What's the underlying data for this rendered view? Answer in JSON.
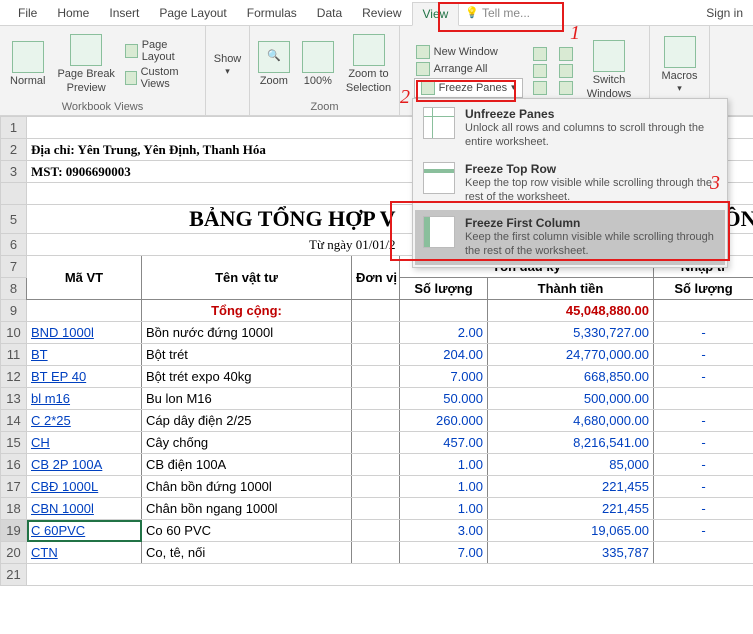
{
  "tabs": [
    "File",
    "Home",
    "Insert",
    "Page Layout",
    "Formulas",
    "Data",
    "Review",
    "View"
  ],
  "active_tab": "View",
  "tell_me": "Tell me...",
  "sign_in": "Sign in",
  "ribbon": {
    "workbook_views": {
      "label": "Workbook Views",
      "normal": "Normal",
      "page_break": "Page Break\nPreview",
      "page_layout": "Page Layout",
      "custom_views": "Custom Views"
    },
    "show": {
      "label": "Show"
    },
    "zoom": {
      "label": "Zoom",
      "zoom": "Zoom",
      "hundred": "100%",
      "zoom_to_selection": "Zoom to\nSelection"
    },
    "window": {
      "new_window": "New Window",
      "arrange_all": "Arrange All",
      "freeze_panes": "Freeze Panes",
      "switch_windows": "Switch\nWindows"
    },
    "macros": {
      "label": "Macros"
    }
  },
  "freeze_dropdown": [
    {
      "title": "Unfreeze Panes",
      "desc": "Unlock all rows and columns to scroll through the entire worksheet."
    },
    {
      "title": "Freeze Top Row",
      "desc": "Keep the top row visible while scrolling through the rest of the worksheet."
    },
    {
      "title": "Freeze First Column",
      "desc": "Keep the first column visible while scrolling through the rest of the worksheet."
    }
  ],
  "annotations": {
    "1": "1",
    "2": "2",
    "3": "3"
  },
  "doc": {
    "address": "Địa chỉ: Yên Trung, Yên Định, Thanh Hóa",
    "mst": "MST:  0906690003",
    "title": "BẢNG TỔNG HỢP V",
    "title_suffix": "ỒN",
    "date": "Từ ngày 01/01/2",
    "headers": {
      "ma_vt": "Mã VT",
      "ten_vt": "Tên vật tư",
      "dvi": "Đơn vị",
      "ton_dau": "Tồn đầu kỳ",
      "so_luong": "Số lượng",
      "thanh_tien": "Thành tiền",
      "nhap": "Nhập tr"
    },
    "tong_cong": "Tổng cộng:",
    "tong_value": "45,048,880.00",
    "rows": [
      {
        "n": "10",
        "ma": "BND 1000l",
        "ten": "Bồn nước đứng 1000l",
        "sl": "2.00",
        "tt": "5,330,727.00",
        "nt": "-"
      },
      {
        "n": "11",
        "ma": "BT",
        "ten": "Bột trét",
        "sl": "204.00",
        "tt": "24,770,000.00",
        "nt": "-"
      },
      {
        "n": "12",
        "ma": "BT EP 40",
        "ten": "Bột trét expo 40kg",
        "sl": "7.000",
        "tt": "668,850.00",
        "nt": "-"
      },
      {
        "n": "13",
        "ma": "bl m16",
        "ten": "Bu lon M16",
        "sl": "50.000",
        "tt": "500,000.00",
        "nt": ""
      },
      {
        "n": "14",
        "ma": "C 2*25",
        "ten": "Cáp dây điện 2/25",
        "sl": "260.000",
        "tt": "4,680,000.00",
        "nt": "-"
      },
      {
        "n": "15",
        "ma": "CH",
        "ten": "Cây chống",
        "sl": "457.00",
        "tt": "8,216,541.00",
        "nt": "-"
      },
      {
        "n": "16",
        "ma": "CB 2P 100A",
        "ten": "CB điện 100A",
        "sl": "1.00",
        "tt": "85,000",
        "nt": "-"
      },
      {
        "n": "17",
        "ma": "CBĐ 1000L",
        "ten": "Chân bồn đứng 1000l",
        "sl": "1.00",
        "tt": "221,455",
        "nt": "-"
      },
      {
        "n": "18",
        "ma": "CBN 1000l",
        "ten": "Chân bồn ngang 1000l",
        "sl": "1.00",
        "tt": "221,455",
        "nt": "-"
      },
      {
        "n": "19",
        "ma": "C 60PVC",
        "ten": "Co 60 PVC",
        "sl": "3.00",
        "tt": "19,065.00",
        "nt": "-"
      },
      {
        "n": "20",
        "ma": "CTN",
        "ten": "Co, tê, nối",
        "sl": "7.00",
        "tt": "335,787",
        "nt": ""
      }
    ]
  }
}
